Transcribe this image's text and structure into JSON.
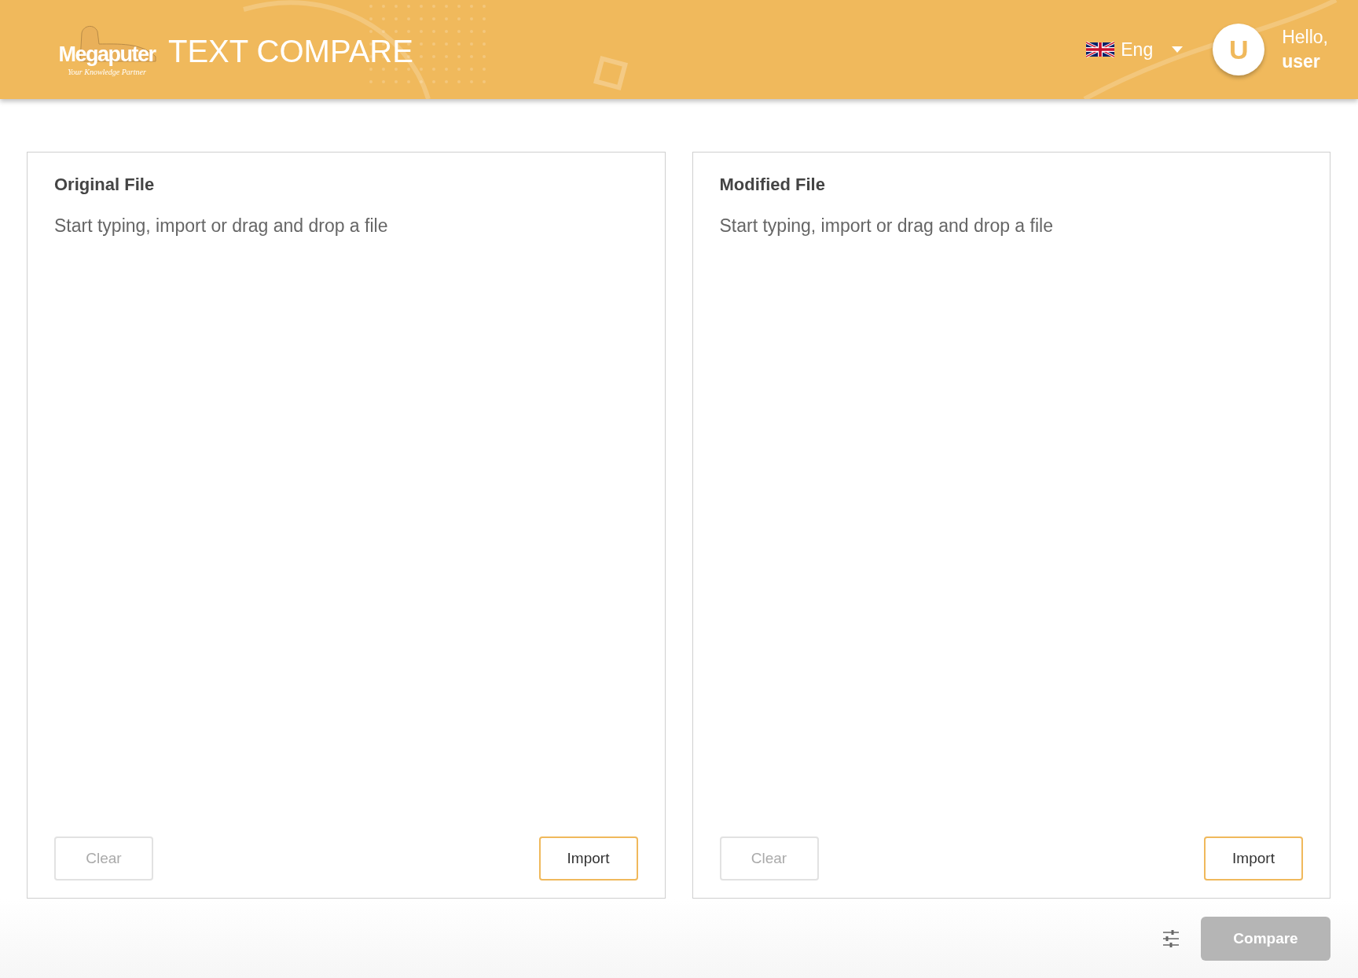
{
  "header": {
    "logo": {
      "name": "Megaputer",
      "tagline": "Your Knowledge Partner"
    },
    "title": "TEXT COMPARE",
    "language": {
      "label": "Eng"
    },
    "user": {
      "initial": "U",
      "greeting": "Hello,",
      "name": "user"
    }
  },
  "panels": [
    {
      "title": "Original File",
      "placeholder": "Start typing, import or drag and drop a file",
      "buttons": [
        {
          "kind": "clear",
          "label": "Clear",
          "disabled": true
        },
        {
          "kind": "import",
          "label": "Import",
          "disabled": false
        }
      ]
    },
    {
      "title": "Modified File",
      "placeholder": "Start typing, import or drag and drop a file",
      "buttons": [
        {
          "kind": "clear",
          "label": "Clear",
          "disabled": true
        },
        {
          "kind": "import",
          "label": "Import",
          "disabled": false
        }
      ]
    }
  ],
  "footer": {
    "compare": {
      "label": "Compare",
      "disabled": true
    }
  }
}
